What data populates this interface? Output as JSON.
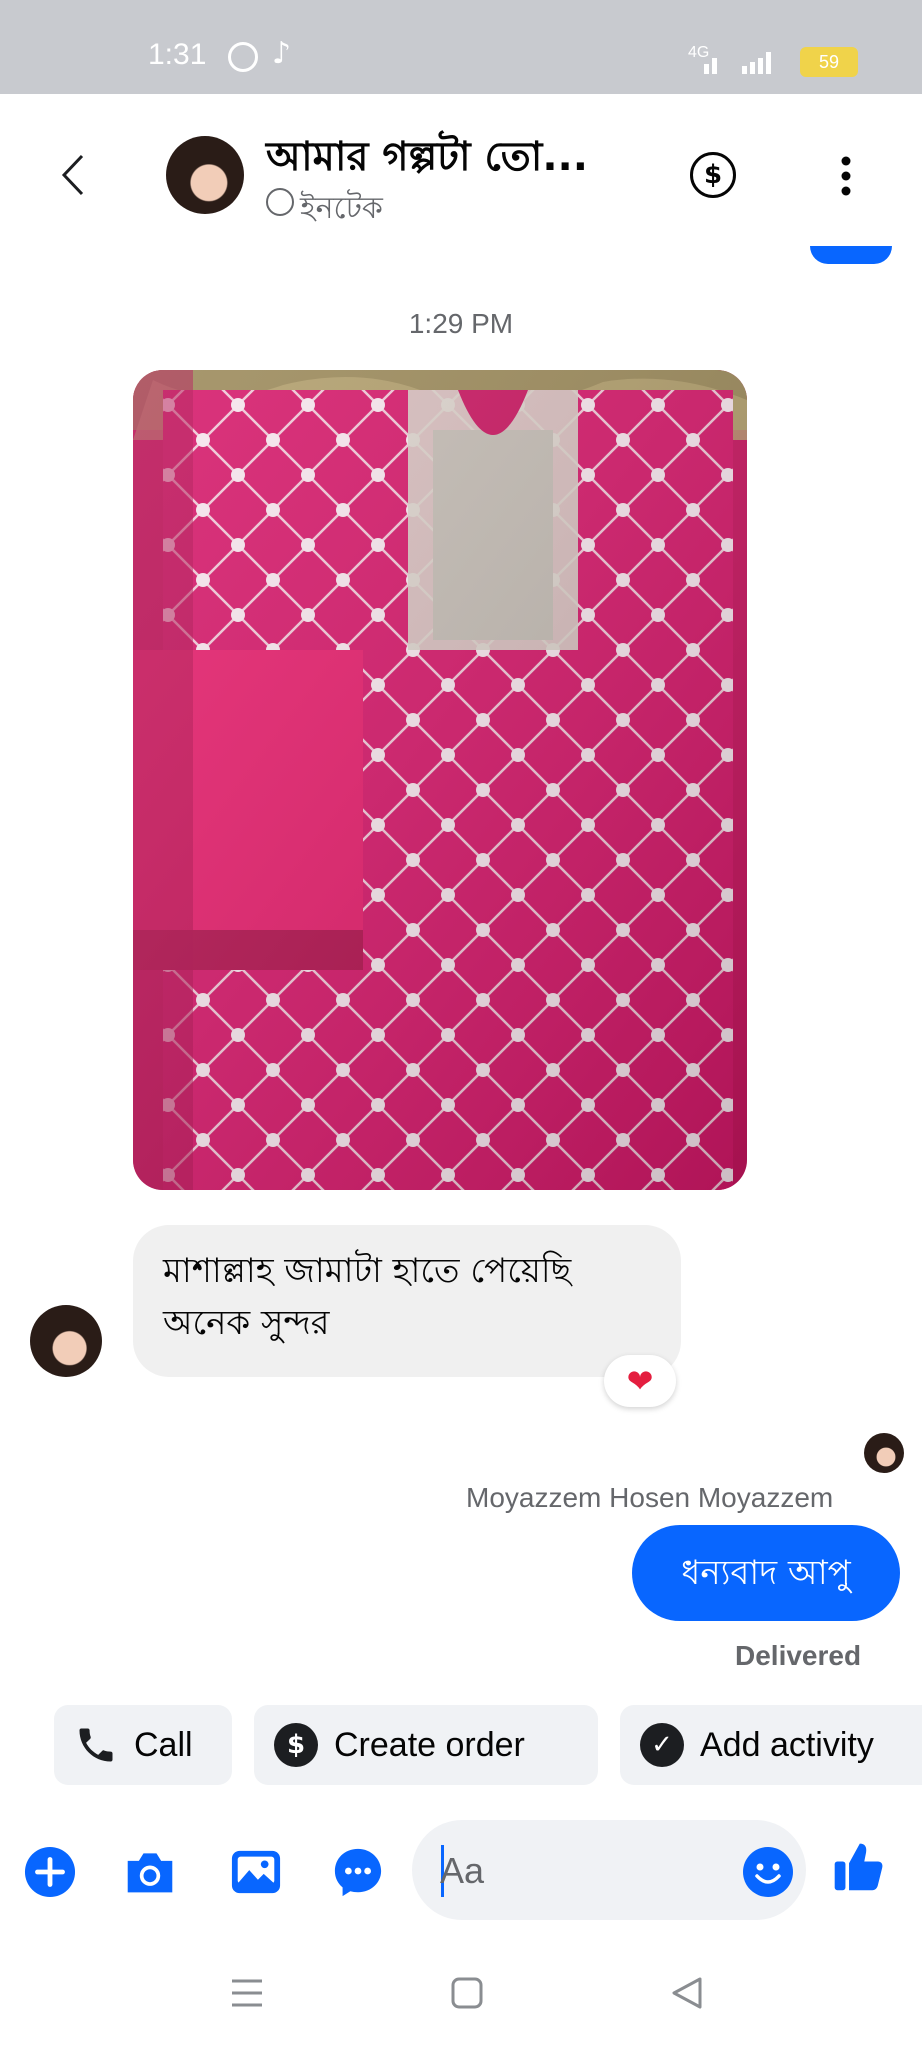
{
  "status_bar": {
    "time": "1:31",
    "network": "4G",
    "battery": "59"
  },
  "header": {
    "back_icon": "chevron-left-icon",
    "title": "আমার গল্পটা তো...",
    "subtitle": "ইনটেক",
    "dollar_icon": "dollar-circle-icon",
    "more_icon": "more-vertical-icon"
  },
  "conversation": {
    "timestamp": "1:29 PM",
    "incoming_message": "মাশাল্লাহ জামাটা হাতে পেয়েছি অনেক সুন্দর",
    "reaction": "❤",
    "sender_name": "Moyazzem Hosen Moyazzem",
    "outgoing_message": "ধন্যবাদ আপু",
    "delivery_status": "Delivered"
  },
  "quick_actions": [
    {
      "label": "Call",
      "icon": "phone-icon"
    },
    {
      "label": "Create order",
      "icon": "dollar-icon"
    },
    {
      "label": "Add activity",
      "icon": "check-icon"
    }
  ],
  "composer": {
    "placeholder": "Aa",
    "icons": [
      "plus-icon",
      "camera-icon",
      "image-icon",
      "chat-bubble-icon",
      "emoji-icon",
      "thumbs-up-icon"
    ],
    "accent_color": "#0866ff"
  },
  "nav_bar": {
    "icons": [
      "menu-icon",
      "home-square-icon",
      "back-triangle-icon"
    ]
  }
}
